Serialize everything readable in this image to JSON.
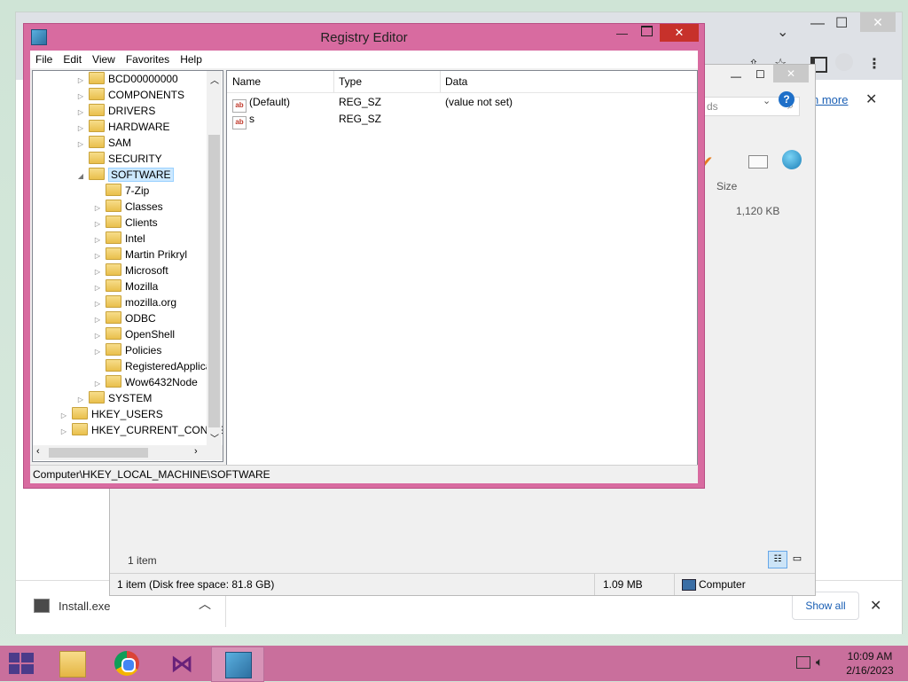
{
  "browser": {
    "download_item": "Install.exe",
    "show_all_label": "Show all",
    "learn_more": "n more"
  },
  "explorer": {
    "search_placeholder": "ds",
    "col_size": "Size",
    "file_size": "1,120 KB",
    "items_count": "1 item",
    "status_left": "1 item (Disk free space: 81.8 GB)",
    "status_size": "1.09 MB",
    "status_location": "Computer"
  },
  "regedit": {
    "title": "Registry Editor",
    "menu": [
      "File",
      "Edit",
      "View",
      "Favorites",
      "Help"
    ],
    "tree": [
      {
        "label": "BCD00000000",
        "level": 1,
        "expander": "▷"
      },
      {
        "label": "COMPONENTS",
        "level": 1,
        "expander": "▷"
      },
      {
        "label": "DRIVERS",
        "level": 1,
        "expander": "▷"
      },
      {
        "label": "HARDWARE",
        "level": 1,
        "expander": "▷"
      },
      {
        "label": "SAM",
        "level": 1,
        "expander": "▷"
      },
      {
        "label": "SECURITY",
        "level": 1,
        "expander": ""
      },
      {
        "label": "SOFTWARE",
        "level": 1,
        "expander": "◢",
        "selected": true
      },
      {
        "label": "7-Zip",
        "level": 2,
        "expander": ""
      },
      {
        "label": "Classes",
        "level": 2,
        "expander": "▷"
      },
      {
        "label": "Clients",
        "level": 2,
        "expander": "▷"
      },
      {
        "label": "Intel",
        "level": 2,
        "expander": "▷"
      },
      {
        "label": "Martin Prikryl",
        "level": 2,
        "expander": "▷"
      },
      {
        "label": "Microsoft",
        "level": 2,
        "expander": "▷"
      },
      {
        "label": "Mozilla",
        "level": 2,
        "expander": "▷"
      },
      {
        "label": "mozilla.org",
        "level": 2,
        "expander": "▷"
      },
      {
        "label": "ODBC",
        "level": 2,
        "expander": "▷"
      },
      {
        "label": "OpenShell",
        "level": 2,
        "expander": "▷"
      },
      {
        "label": "Policies",
        "level": 2,
        "expander": "▷"
      },
      {
        "label": "RegisteredApplica",
        "level": 2,
        "expander": ""
      },
      {
        "label": "Wow6432Node",
        "level": 2,
        "expander": "▷"
      },
      {
        "label": "SYSTEM",
        "level": 1,
        "expander": "▷"
      },
      {
        "label": "HKEY_USERS",
        "level": 0,
        "expander": "▷"
      },
      {
        "label": "HKEY_CURRENT_CONFIG",
        "level": 0,
        "expander": "▷"
      }
    ],
    "columns": {
      "name": "Name",
      "type": "Type",
      "data": "Data"
    },
    "values": [
      {
        "name": "(Default)",
        "type": "REG_SZ",
        "data": "(value not set)"
      },
      {
        "name": "s",
        "type": "REG_SZ",
        "data": ""
      }
    ],
    "status_path": "Computer\\HKEY_LOCAL_MACHINE\\SOFTWARE"
  },
  "taskbar": {
    "time": "10:09 AM",
    "date": "2/16/2023"
  }
}
